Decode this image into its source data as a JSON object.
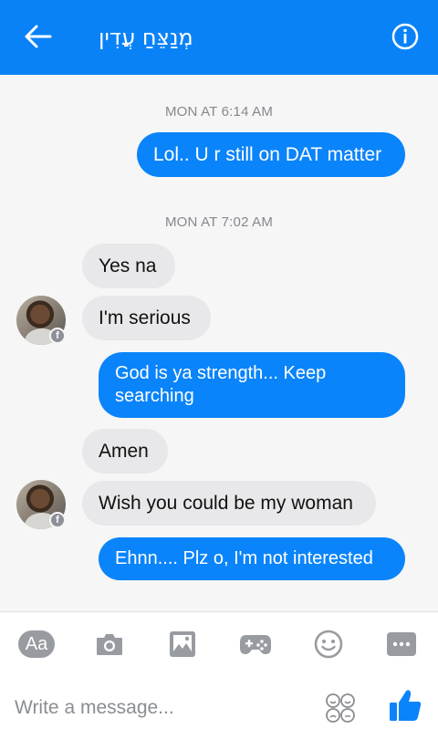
{
  "header": {
    "title": "מְנַצֵּחַ עֲדִין",
    "back_icon": "arrow-left-icon",
    "info_icon": "info-circle-icon",
    "color": "#0a82f7"
  },
  "thread": {
    "timestamps": [
      "MON AT 6:14 AM",
      "MON AT 7:02 AM"
    ],
    "messages": [
      {
        "text": "Lol.. U r still on DAT matter",
        "direction": "outgoing"
      },
      {
        "text": "Yes na",
        "direction": "incoming"
      },
      {
        "text": "I'm serious",
        "direction": "incoming"
      },
      {
        "text": "God is ya strength... Keep searching",
        "direction": "outgoing"
      },
      {
        "text": "Amen",
        "direction": "incoming"
      },
      {
        "text": "Wish you could be my woman",
        "direction": "incoming"
      },
      {
        "text": "Ehnn.... Plz o,  I'm not interested",
        "direction": "outgoing"
      }
    ],
    "outgoing_color": "#0a84fa",
    "incoming_color": "#e8e8ea"
  },
  "toolbar": {
    "text_style_label": "Aa",
    "icons": [
      "camera-icon",
      "gallery-icon",
      "game-controller-icon",
      "emoji-icon",
      "more-icon"
    ]
  },
  "composer": {
    "placeholder": "Write a message...",
    "emoji_picker_icon": "sticker-face-icon",
    "send_icon": "thumbs-up-icon"
  }
}
